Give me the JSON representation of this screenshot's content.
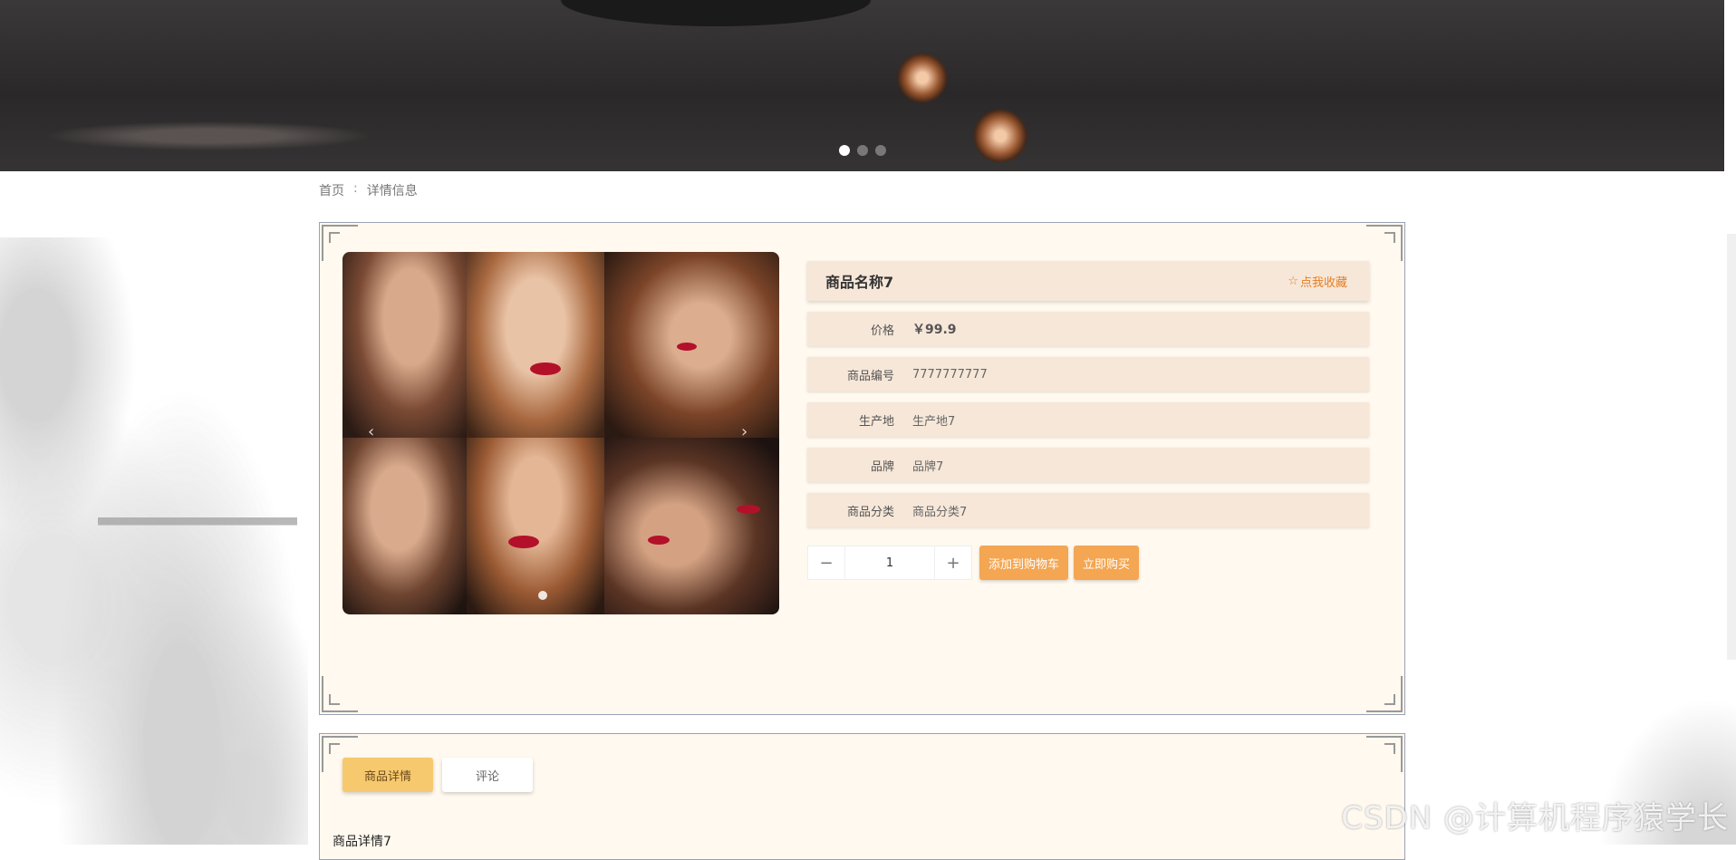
{
  "banner": {
    "dots": 3,
    "active_index": 0
  },
  "breadcrumb": {
    "home": "首页",
    "separator": ":",
    "current": "详情信息"
  },
  "product": {
    "title": "商品名称7",
    "favorite_label": "点我收藏",
    "fields": [
      {
        "label": "价格",
        "value": "￥99.9"
      },
      {
        "label": "商品编号",
        "value": "7777777777"
      },
      {
        "label": "生产地",
        "value": "生产地7"
      },
      {
        "label": "品牌",
        "value": "品牌7"
      },
      {
        "label": "商品分类",
        "value": "商品分类7"
      }
    ],
    "quantity": "1",
    "minus": "−",
    "plus": "+",
    "add_to_cart": "添加到购物车",
    "buy_now": "立即购买"
  },
  "tabs": [
    {
      "label": "商品详情",
      "active": true
    },
    {
      "label": "评论",
      "active": false
    }
  ],
  "detail_title": "商品详情7",
  "watermark": "CSDN @计算机程序猿学长",
  "colors": {
    "accent": "#f4a652",
    "tab_active": "#f7c96e",
    "panel_bg": "#fff9ef",
    "row_bg": "#f6e7d8"
  }
}
